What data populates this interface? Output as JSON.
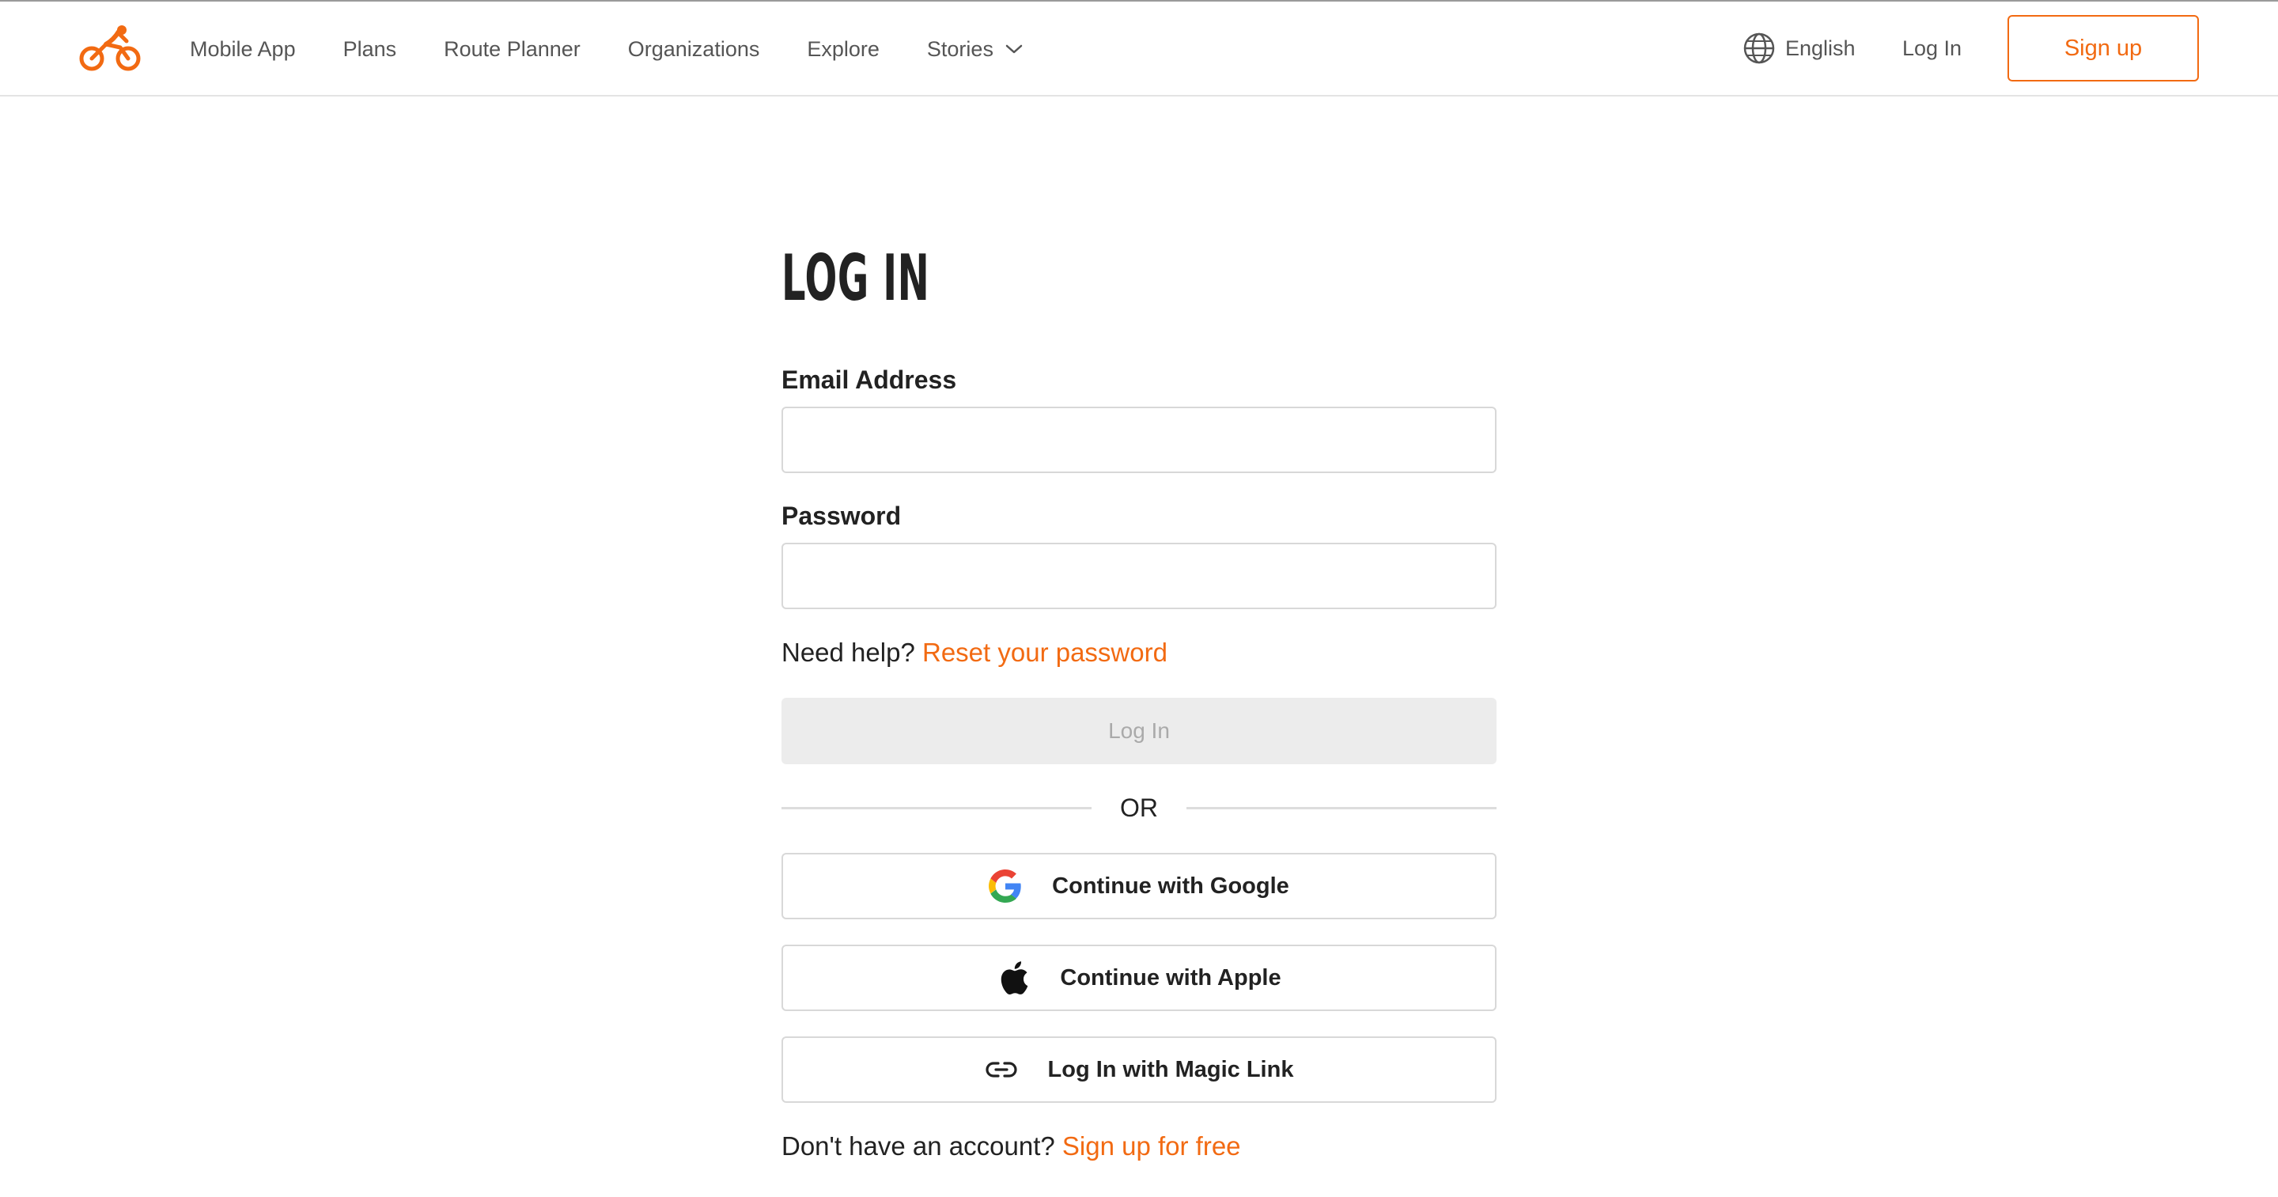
{
  "brand": {
    "accent": "#f26a12"
  },
  "header": {
    "nav": [
      {
        "label": "Mobile App"
      },
      {
        "label": "Plans"
      },
      {
        "label": "Route Planner"
      },
      {
        "label": "Organizations"
      },
      {
        "label": "Explore"
      },
      {
        "label": "Stories",
        "icon": "chevron-down-icon"
      }
    ],
    "language": {
      "label": "English",
      "icon": "globe-icon"
    },
    "login_label": "Log In",
    "signup_label": "Sign up"
  },
  "login": {
    "title": "LOG IN",
    "email": {
      "label": "Email Address",
      "value": "",
      "placeholder": ""
    },
    "password": {
      "label": "Password",
      "value": "",
      "placeholder": ""
    },
    "help_text": "Need help?",
    "reset_link": "Reset your password",
    "submit_label": "Log In",
    "or_text": "OR",
    "google_label": "Continue with Google",
    "apple_label": "Continue with Apple",
    "magic_link_label": "Log In with Magic Link",
    "no_account_text": "Don't have an account?",
    "signup_link": "Sign up for free"
  }
}
